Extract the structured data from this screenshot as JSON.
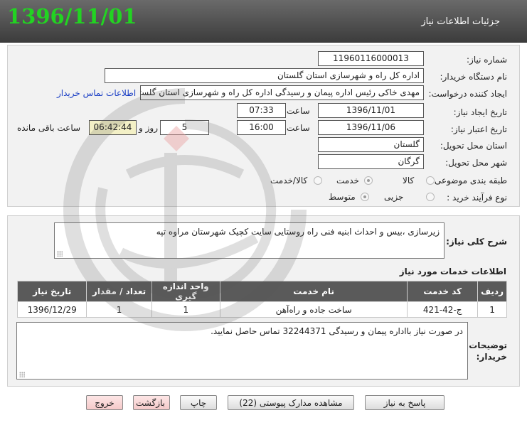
{
  "header": {
    "title": "جزئیات اطلاعات نیاز",
    "date": "1396/11/01"
  },
  "form": {
    "need_number": {
      "label": "شماره نیاز:",
      "value": "11960116000013"
    },
    "buyer_org": {
      "label": "نام دستگاه خریدار:",
      "value": "اداره کل راه و شهرسازی استان گلستان"
    },
    "requester": {
      "label": "ایجاد کننده درخواست:",
      "value": "مهدی خاکی رئیس اداره پیمان و رسیدگی اداره کل راه و شهرسازی استان گلستان",
      "contact_link": "اطلاعات تماس خریدار"
    },
    "created": {
      "label": "تاریخ ایجاد نیاز:",
      "date": "1396/11/01",
      "time_label": "ساعت",
      "time": "07:33"
    },
    "validity": {
      "label": "تاریخ اعتبار نیاز:",
      "date": "1396/11/06",
      "time_label": "ساعت",
      "time": "16:00",
      "days": "5",
      "days_label": "روز و",
      "remaining": "06:42:44",
      "remaining_label": "ساعت باقی مانده"
    },
    "province": {
      "label": "استان محل تحویل:",
      "value": "گلستان"
    },
    "city": {
      "label": "شهر محل تحویل:",
      "value": "گرگان"
    },
    "category": {
      "label": "طبقه بندی موضوعی:",
      "options": [
        "کالا",
        "خدمت",
        "کالا/خدمت"
      ],
      "selected": "خدمت"
    },
    "purchase_type": {
      "label": "نوع فرآیند خرید :",
      "options": [
        "جزیی",
        "متوسط"
      ],
      "selected": "متوسط"
    }
  },
  "description": {
    "label": "شرح کلی نیاز:",
    "value": "زیرسازی ،بیس و احداث ابنیه فنی راه روستایی سایت کچیک شهرستان مراوه تپه"
  },
  "services": {
    "title": "اطلاعات خدمات مورد نیاز",
    "columns": [
      "ردیف",
      "کد خدمت",
      "نام خدمت",
      "واحد اندازه گیری",
      "تعداد / مقدار",
      "تاریخ نیاز"
    ],
    "rows": [
      [
        "1",
        "ج-42-421",
        "ساخت جاده و راه‌آهن",
        "1",
        "1",
        "1396/12/29"
      ]
    ]
  },
  "buyer_notes": {
    "label": "توضیحات خریدار:",
    "value": "در صورت نیاز بااداره پیمان و رسیدگی 32244371 تماس حاصل نمایید."
  },
  "buttons": {
    "reply": "پاسخ به نیاز",
    "documents": "مشاهده مدارک پیوستی (22)",
    "print": "چاپ",
    "back": "بازگشت",
    "exit": "خروج"
  },
  "colors": {
    "header_date": "#22d422",
    "link": "#1b3fc5",
    "table_header": "#5a5a5a",
    "remaining_bg": "#f3f0c6"
  }
}
